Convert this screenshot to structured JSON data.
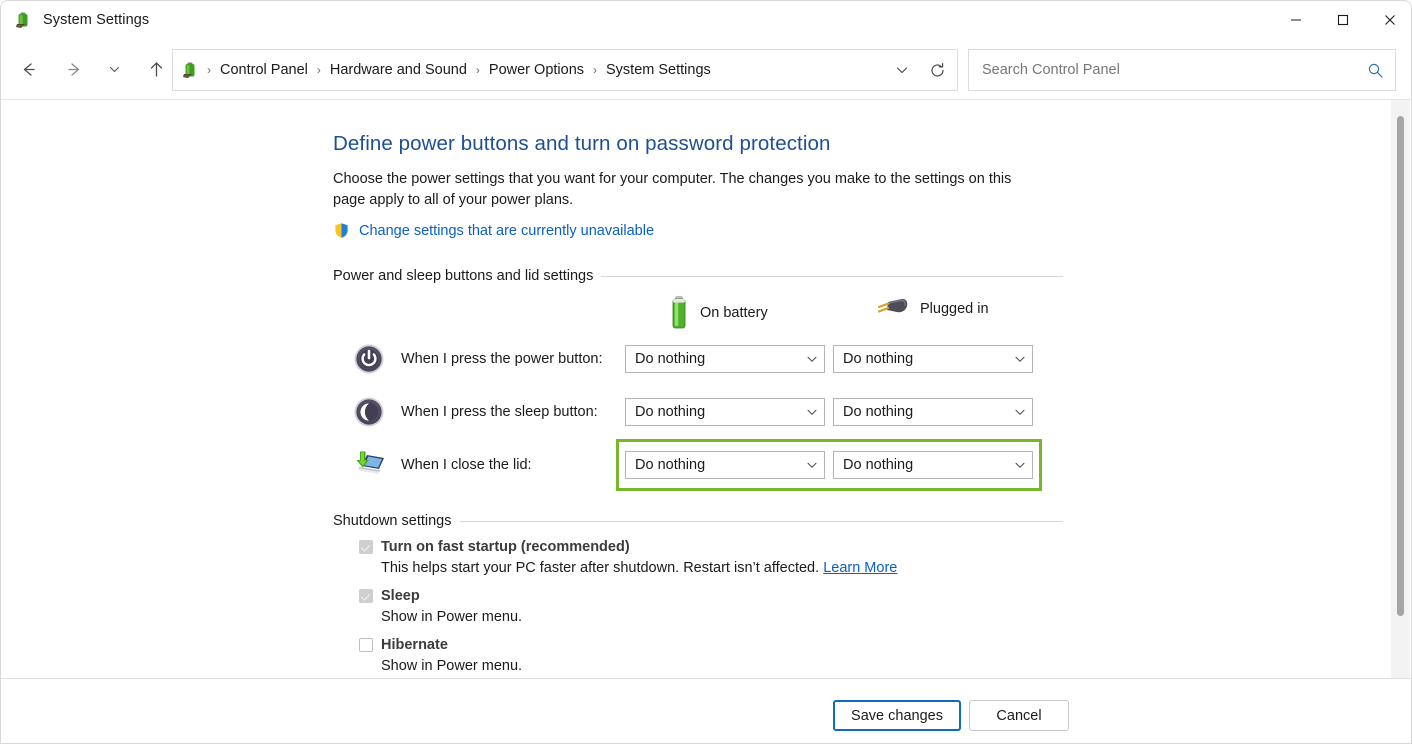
{
  "window": {
    "title": "System Settings",
    "title_icon": "battery-icon",
    "controls": {
      "minimize": "minimize-icon",
      "maximize": "maximize-icon",
      "close": "close-icon"
    }
  },
  "nav": {
    "back": "back-arrow-icon",
    "forward": "forward-arrow-icon",
    "recent": "recent-locations-chevron-icon",
    "up": "up-arrow-icon",
    "address_icon": "battery-icon",
    "breadcrumbs": [
      "Control Panel",
      "Hardware and Sound",
      "Power Options",
      "System Settings"
    ],
    "separator": "›",
    "address_chevron": "chevron-down-icon",
    "refresh": "refresh-icon"
  },
  "search": {
    "placeholder": "Search Control Panel",
    "value": "",
    "icon": "search-icon"
  },
  "main": {
    "title": "Define power buttons and turn on password protection",
    "description": "Choose the power settings that you want for your computer. The changes you make to the settings on this page apply to all of your power plans.",
    "uac_link": "Change settings that are currently unavailable",
    "uac_icon": "shield-icon"
  },
  "power_group": {
    "label": "Power and sleep buttons and lid settings",
    "columns": [
      {
        "label": "On battery",
        "icon": "battery-icon"
      },
      {
        "label": "Plugged in",
        "icon": "power-plug-icon"
      }
    ],
    "rows": [
      {
        "icon": "power-button-icon",
        "label": "When I press the power button:",
        "on_battery": "Do nothing",
        "plugged_in": "Do nothing",
        "highlighted": false
      },
      {
        "icon": "sleep-button-icon",
        "label": "When I press the sleep button:",
        "on_battery": "Do nothing",
        "plugged_in": "Do nothing",
        "highlighted": false
      },
      {
        "icon": "laptop-lid-icon",
        "label": "When I close the lid:",
        "on_battery": "Do nothing",
        "plugged_in": "Do nothing",
        "highlighted": true
      }
    ]
  },
  "shutdown_group": {
    "label": "Shutdown settings",
    "items": [
      {
        "label": "Turn on fast startup (recommended)",
        "checked": true,
        "disabled": true,
        "description": "This helps start your PC faster after shutdown. Restart isn’t affected.",
        "link": "Learn More"
      },
      {
        "label": "Sleep",
        "checked": true,
        "disabled": true,
        "description": "Show in Power menu.",
        "link": ""
      },
      {
        "label": "Hibernate",
        "checked": false,
        "disabled": false,
        "description": "Show in Power menu.",
        "link": ""
      }
    ]
  },
  "footer": {
    "save_label": "Save changes",
    "cancel_label": "Cancel"
  },
  "colors": {
    "heading_blue": "#1f4f93",
    "link_blue": "#0a5fc4",
    "highlight_green": "#76b82a",
    "default_button_border": "#0f6cbd",
    "battery_green": "#4fb32a"
  },
  "scrollbar": {
    "name": "vertical-scrollbar"
  }
}
